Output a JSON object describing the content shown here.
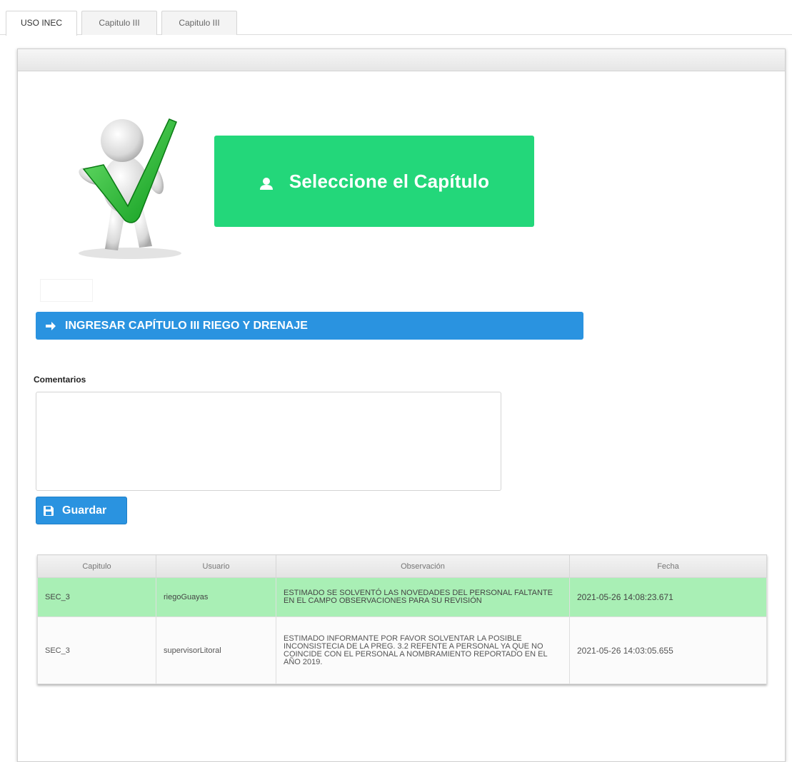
{
  "tabs": [
    {
      "label": "USO INEC",
      "active": true
    },
    {
      "label": "Capitulo III",
      "active": false
    },
    {
      "label": "Capitulo III",
      "active": false
    }
  ],
  "main": {
    "select_button": {
      "label": "Seleccione el Capítulo",
      "icon": "user-icon",
      "color": "#23d77a"
    },
    "ingresar_button": {
      "label": "INGRESAR CAPÍTULO III RIEGO Y DRENAJE",
      "icon": "arrow-right-icon",
      "color": "#2a93e0"
    },
    "comentarios": {
      "label": "Comentarios",
      "value": "",
      "placeholder": ""
    },
    "guardar_button": {
      "label": "Guardar",
      "icon": "floppy-disk-icon"
    }
  },
  "table": {
    "headers": [
      "Capitulo",
      "Usuario",
      "Observación",
      "Fecha"
    ],
    "rows": [
      {
        "capitulo": "SEC_3",
        "usuario": "riegoGuayas",
        "observacion": "ESTIMADO SE SOLVENTÓ LAS NOVEDADES DEL PERSONAL FALTANTE EN EL CAMPO OBSERVACIONES PARA SU REVISIÓN",
        "fecha": "2021-05-26 14:08:23.671",
        "highlight": true
      },
      {
        "capitulo": "SEC_3",
        "usuario": "supervisorLitoral",
        "observacion": "ESTIMADO INFORMANTE POR FAVOR SOLVENTAR LA POSIBLE INCONSISTECIA DE LA PREG. 3.2 REFENTE A PERSONAL YA QUE NO COINCIDE CON EL PERSONAL A NOMBRAMIENTO REPORTADO EN EL AÑO 2019.",
        "fecha": "2021-05-26 14:03:05.655",
        "highlight": false
      }
    ]
  }
}
